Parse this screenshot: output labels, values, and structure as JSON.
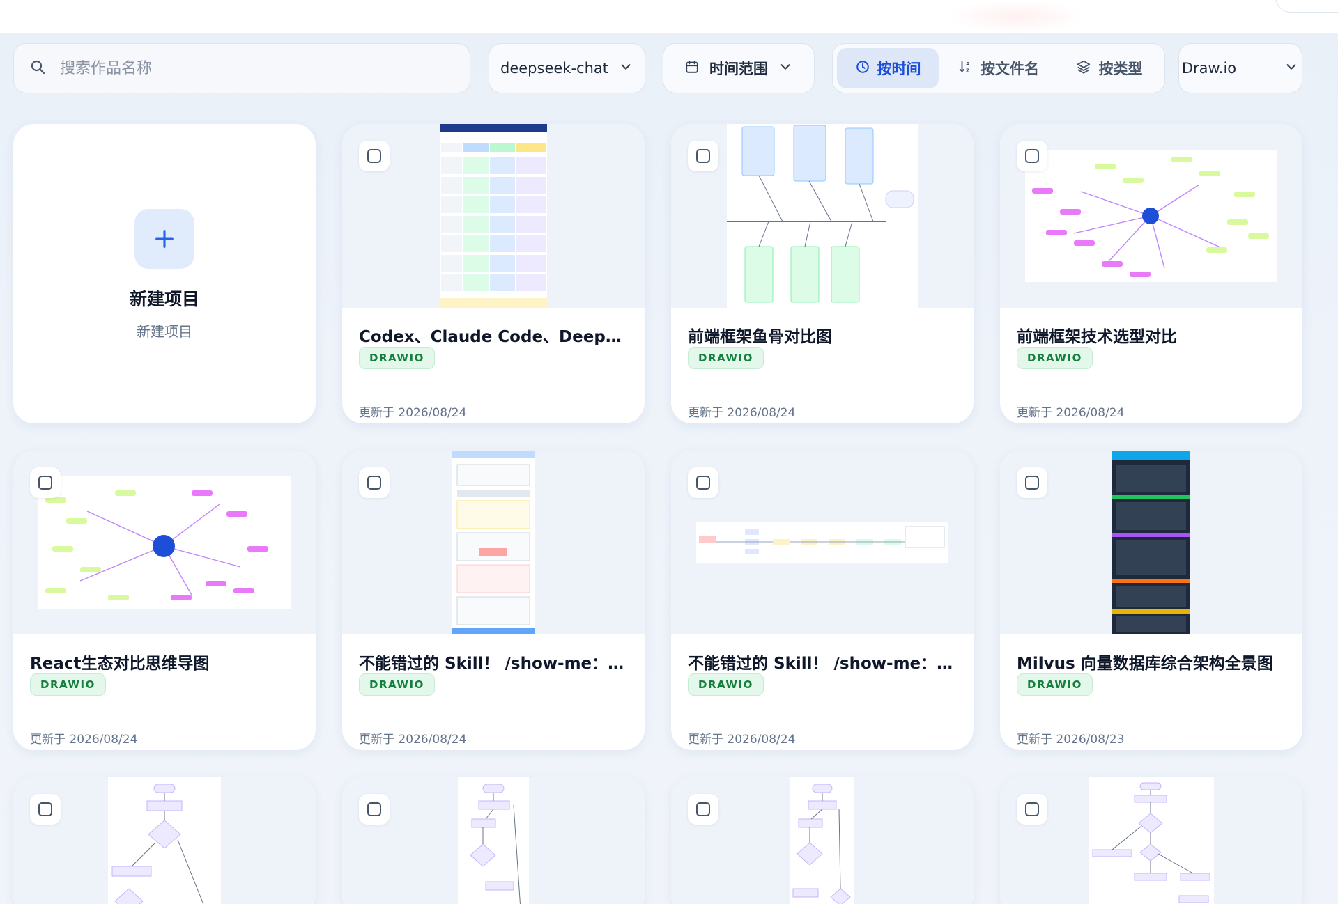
{
  "toolbar": {
    "search_placeholder": "搜索作品名称",
    "model_label": "deepseek-chat",
    "time_range_label": "时间范围",
    "sort_by_time": "按时间",
    "sort_by_filename": "按文件名",
    "sort_by_type": "按类型",
    "format_label": "Draw.io"
  },
  "new_project": {
    "title": "新建项目",
    "subtitle": "新建项目"
  },
  "cards": [
    {
      "title": "Codex、Claude Code、DeepSeek TUI 对比",
      "type": "DRAWIO",
      "updated": "更新于 2026/08/24"
    },
    {
      "title": "前端框架鱼骨对比图",
      "type": "DRAWIO",
      "updated": "更新于 2026/08/24"
    },
    {
      "title": "前端框架技术选型对比",
      "type": "DRAWIO",
      "updated": "更新于 2026/08/24"
    },
    {
      "title": "React生态对比思维导图",
      "type": "DRAWIO",
      "updated": "更新于 2026/08/24"
    },
    {
      "title": "不能错过的 Skill！ /show-me：让 Agent 可视化",
      "type": "DRAWIO",
      "updated": "更新于 2026/08/24"
    },
    {
      "title": "不能错过的 Skill！ /show-me：让 Agent 可视化",
      "type": "DRAWIO",
      "updated": "更新于 2026/08/24"
    },
    {
      "title": "Milvus 向量数据库综合架构全景图",
      "type": "DRAWIO",
      "updated": "更新于 2026/08/23"
    }
  ],
  "icons": {
    "search": "search-icon",
    "calendar": "calendar-icon",
    "clock": "clock-icon",
    "sort": "sort-az-icon",
    "layers": "layers-icon",
    "chevron": "chevron-down-icon",
    "plus": "plus-icon",
    "checkbox": "checkbox-icon"
  },
  "colors": {
    "accent": "#2563eb",
    "badge_bg": "#e3f7ea",
    "badge_text": "#15803d",
    "active_sort_bg": "#dde7f7"
  }
}
